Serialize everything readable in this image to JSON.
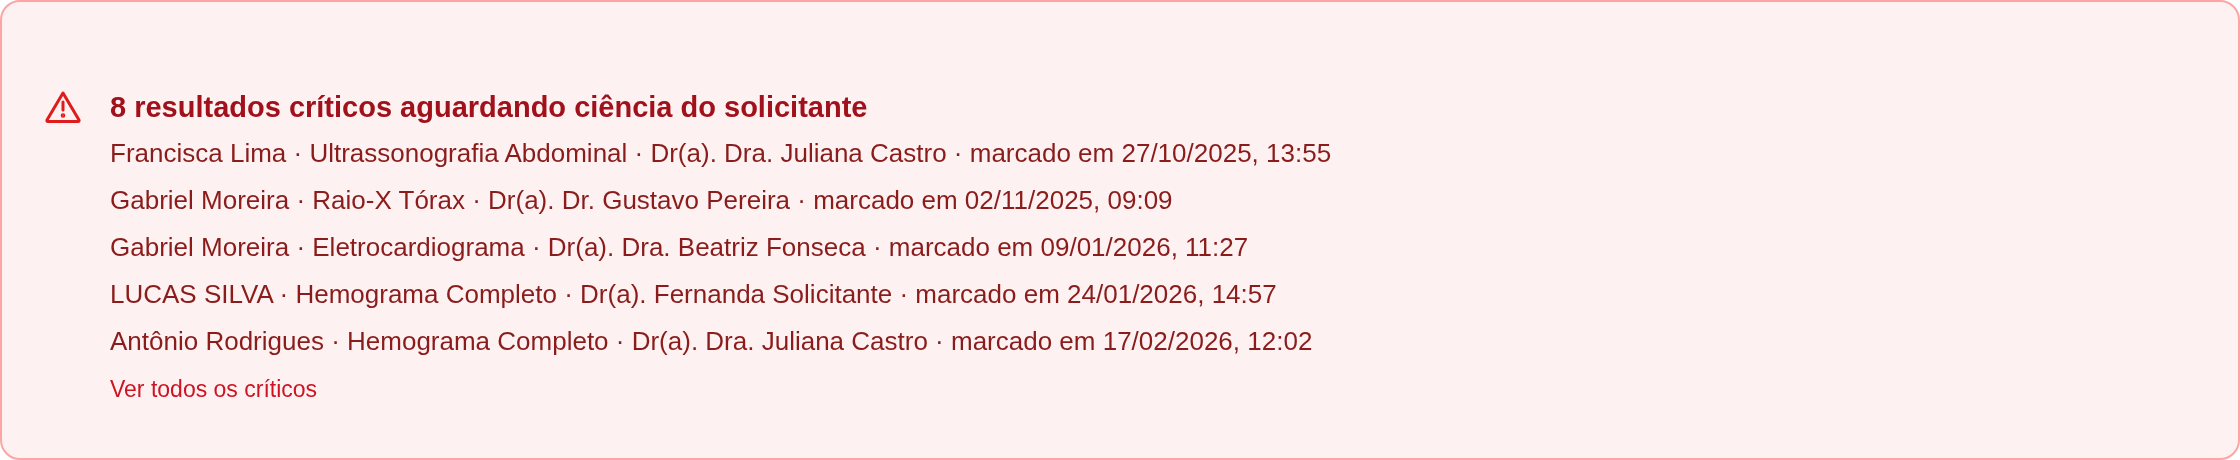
{
  "alert": {
    "title": "8 resultados críticos aguardando ciência do solicitante",
    "items": [
      "Francisca Lima · Ultrassonografia Abdominal · Dr(a). Dra. Juliana Castro · marcado em 27/10/2025, 13:55",
      "Gabriel Moreira · Raio-X Tórax · Dr(a). Dr. Gustavo Pereira · marcado em 02/11/2025, 09:09",
      "Gabriel Moreira · Eletrocardiograma · Dr(a). Dra. Beatriz Fonseca · marcado em 09/01/2026, 11:27",
      "LUCAS SILVA · Hemograma Completo · Dr(a). Fernanda Solicitante · marcado em 24/01/2026, 14:57",
      "Antônio Rodrigues · Hemograma Completo · Dr(a). Dra. Juliana Castro · marcado em 17/02/2026, 12:02"
    ],
    "link": "Ver todos os críticos"
  }
}
